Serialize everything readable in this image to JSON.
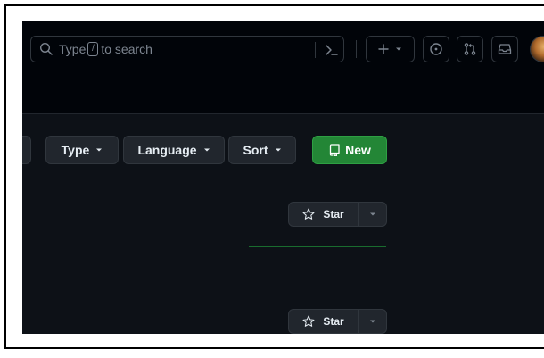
{
  "header": {
    "search": {
      "prefix": "Type",
      "slash_key": "/",
      "suffix": "to search"
    },
    "icons": [
      "search-icon",
      "command-palette-icon",
      "plus-icon",
      "chevron-down-icon",
      "issue-icon",
      "pull-request-icon",
      "inbox-icon"
    ],
    "avatar": "user-avatar"
  },
  "toolbar": {
    "type_label": "Type",
    "language_label": "Language",
    "sort_label": "Sort",
    "new_label": "New"
  },
  "repos": [
    {
      "star_label": "Star"
    },
    {
      "star_label": "Star"
    }
  ],
  "colors": {
    "background": "#0d1117",
    "header_background": "#010409",
    "button_background": "#21262d",
    "border": "#30363d",
    "new_button": "#238636",
    "activity_line": "#196c2e",
    "text": "#e6edf3",
    "muted_text": "#7d8590"
  }
}
